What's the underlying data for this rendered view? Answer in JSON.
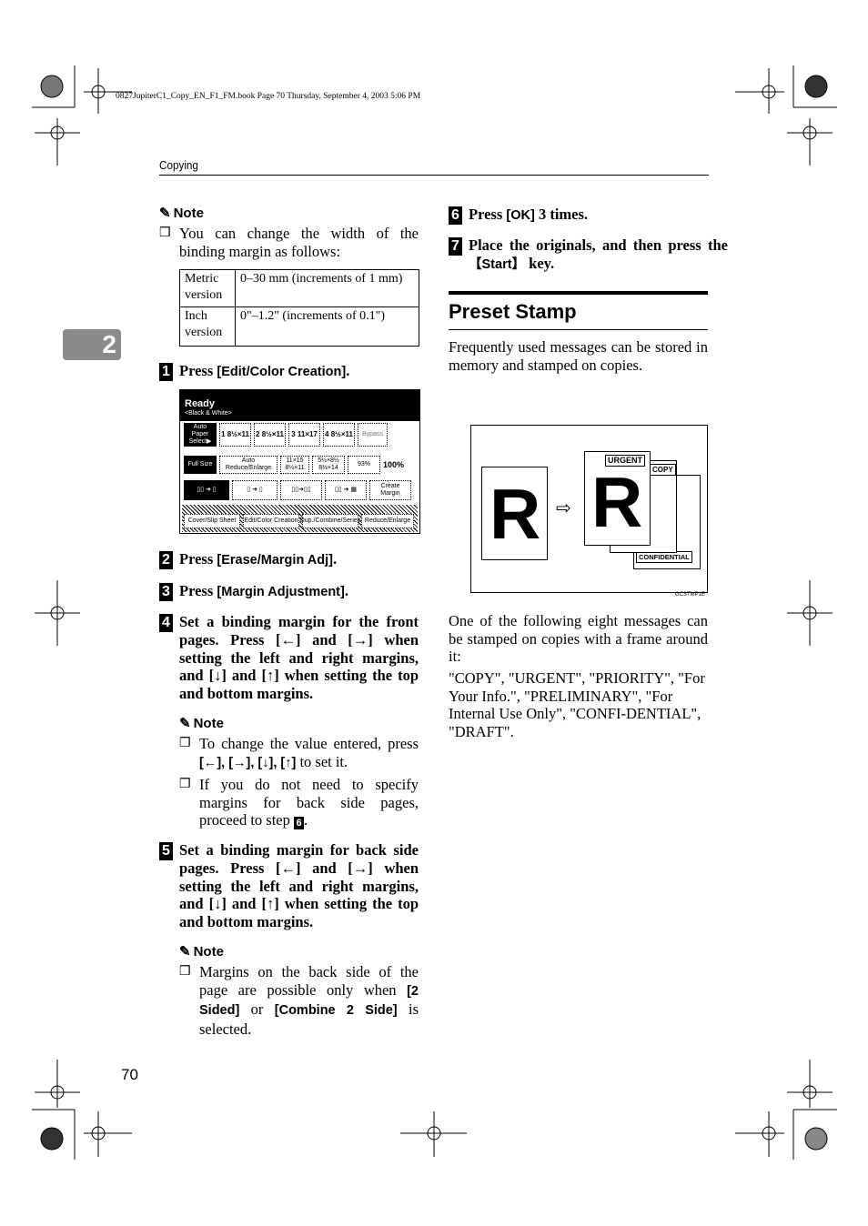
{
  "header": {
    "file_info": "0827JupiterC1_Copy_EN_F1_FM.book  Page 70  Thursday, September 4, 2003  5:06 PM",
    "running_title": "Copying"
  },
  "chapter_tab": "2",
  "page_number": "70",
  "left": {
    "note1": {
      "title": "Note",
      "item": "You can change the width of the binding margin as follows:",
      "table": [
        [
          "Metric version",
          "0–30 mm (increments of 1 mm)"
        ],
        [
          "Inch version",
          "0\"–1.2\" (increments of 0.1\")"
        ]
      ]
    },
    "step1": {
      "num": "1",
      "pre": "Press ",
      "key": "[Edit/Color Creation]",
      "post": "."
    },
    "lcd": {
      "status": "Ready",
      "mode": "<Black & White>",
      "row1": [
        "Auto Paper Select▶",
        "1 8½×11",
        "2 8½×11",
        "3 11×17",
        "4 8½×11",
        "Bypass"
      ],
      "row2": [
        "Full Size",
        "Auto Reduce/Enlarge",
        "11×15 8½×11",
        "5½×8½ 8½×14",
        "93%",
        "100%"
      ],
      "row3_last": "Create Margin",
      "tabs": [
        "Cover/Slip Sheet",
        "Edit/Color Creation",
        "Dup./Combine/Series",
        "Reduce/Enlarge"
      ]
    },
    "step2": {
      "num": "2",
      "pre": "Press ",
      "key": "[Erase/Margin Adj]",
      "post": "."
    },
    "step3": {
      "num": "3",
      "pre": "Press ",
      "key": "[Margin Adjustment]",
      "post": "."
    },
    "step4": {
      "num": "4",
      "text": "Set a binding margin for the front pages. Press [←] and [→] when setting the left and right margins, and [↓] and [↑] when setting the top and bottom margins."
    },
    "note2": {
      "title": "Note",
      "item1_pre": "To change the value entered, press ",
      "item1_keys": "[←], [→], [↓], [↑]",
      "item1_post": " to set it.",
      "item2_pre": "If you do not need to specify margins for back side pages, proceed to step ",
      "item2_step": "6",
      "item2_post": "."
    },
    "step5": {
      "num": "5",
      "text": "Set a binding margin for back side pages. Press [←] and [→] when setting the left and right margins, and [↓] and [↑] when setting the top and bottom margins."
    },
    "note3": {
      "title": "Note",
      "pre": "Margins on the back side of the page are possible only when ",
      "key1": "[2 Sided]",
      "mid": " or ",
      "key2": "[Combine 2 Side]",
      "post": " is selected."
    }
  },
  "right": {
    "step6": {
      "num": "6",
      "pre": "Press ",
      "key": "[OK]",
      "post": " 3 times."
    },
    "step7": {
      "num": "7",
      "pre": "Place the originals, and then press the ",
      "key": "【Start】",
      "post": " key."
    },
    "heading": "Preset Stamp",
    "intro": "Frequently used messages can be stored in memory and stamped on copies.",
    "figure": {
      "letter": "R",
      "stamps": [
        "URGENT",
        "COPY",
        "CONFIDENTIAL"
      ],
      "figure_id": "GCSTMP1E"
    },
    "para1": "One of the following eight messages can be stamped on copies with a frame around it:",
    "para2": "\"COPY\", \"URGENT\", \"PRIORITY\", \"For Your Info.\", \"PRELIMINARY\", \"For Internal Use Only\", \"CONFI-DENTIAL\", \"DRAFT\"."
  },
  "icons": {
    "note": "pencil-icon",
    "checkbox": "square-bullet-icon",
    "crop": "registration-mark-icon"
  }
}
